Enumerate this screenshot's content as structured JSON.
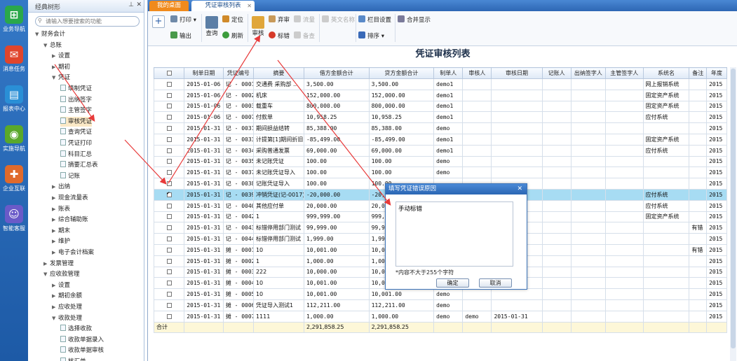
{
  "leftbar": [
    {
      "label": "业务导航",
      "icon": "business-nav-icon",
      "color": "#2aa84a",
      "glyph": "⊞"
    },
    {
      "label": "消息任务",
      "icon": "message-task-icon",
      "color": "#e0452c",
      "glyph": "✉"
    },
    {
      "label": "报表中心",
      "icon": "report-center-icon",
      "color": "#2a8fd6",
      "glyph": "▤"
    },
    {
      "label": "实施导航",
      "icon": "implement-nav-icon",
      "color": "#5aa82a",
      "glyph": "◉"
    },
    {
      "label": "企业互联",
      "icon": "enterprise-link-icon",
      "color": "#e06a2c",
      "glyph": "✚"
    },
    {
      "label": "智能客服",
      "icon": "smart-service-icon",
      "color": "#6a5ac8",
      "glyph": "☺"
    }
  ],
  "tree": {
    "title": "经典树形",
    "search_placeholder": "请输入想要搜索的功能",
    "items": [
      {
        "label": "财务会计",
        "level": 0,
        "arrow": "▼",
        "doc": false
      },
      {
        "label": "总账",
        "level": 1,
        "arrow": "▼",
        "doc": false
      },
      {
        "label": "设置",
        "level": 2,
        "arrow": "▶",
        "doc": false
      },
      {
        "label": "期初",
        "level": 2,
        "arrow": "▶",
        "doc": false
      },
      {
        "label": "凭证",
        "level": 2,
        "arrow": "▼",
        "doc": false
      },
      {
        "label": "填制凭证",
        "level": 3,
        "arrow": "",
        "doc": true
      },
      {
        "label": "出纳签字",
        "level": 3,
        "arrow": "",
        "doc": true
      },
      {
        "label": "主管签字",
        "level": 3,
        "arrow": "",
        "doc": true
      },
      {
        "label": "审核凭证",
        "level": 3,
        "arrow": "",
        "doc": true,
        "selected": true
      },
      {
        "label": "查询凭证",
        "level": 3,
        "arrow": "",
        "doc": true
      },
      {
        "label": "凭证打印",
        "level": 3,
        "arrow": "",
        "doc": true
      },
      {
        "label": "科目汇总",
        "level": 3,
        "arrow": "",
        "doc": true
      },
      {
        "label": "摘要汇总表",
        "level": 3,
        "arrow": "",
        "doc": true
      },
      {
        "label": "记账",
        "level": 3,
        "arrow": "",
        "doc": true
      },
      {
        "label": "出纳",
        "level": 2,
        "arrow": "▶",
        "doc": false
      },
      {
        "label": "现金流量表",
        "level": 2,
        "arrow": "▶",
        "doc": false
      },
      {
        "label": "账表",
        "level": 2,
        "arrow": "▶",
        "doc": false
      },
      {
        "label": "综合辅助账",
        "level": 2,
        "arrow": "▶",
        "doc": false
      },
      {
        "label": "期末",
        "level": 2,
        "arrow": "▶",
        "doc": false
      },
      {
        "label": "维护",
        "level": 2,
        "arrow": "▶",
        "doc": false
      },
      {
        "label": "电子会计档案",
        "level": 2,
        "arrow": "▶",
        "doc": false
      },
      {
        "label": "发票管理",
        "level": 1,
        "arrow": "▶",
        "doc": false
      },
      {
        "label": "应收款管理",
        "level": 1,
        "arrow": "▼",
        "doc": false
      },
      {
        "label": "设置",
        "level": 2,
        "arrow": "▶",
        "doc": false
      },
      {
        "label": "期初余额",
        "level": 2,
        "arrow": "▶",
        "doc": false
      },
      {
        "label": "应收处理",
        "level": 2,
        "arrow": "▶",
        "doc": false
      },
      {
        "label": "收款处理",
        "level": 2,
        "arrow": "▼",
        "doc": false
      },
      {
        "label": "选择收款",
        "level": 3,
        "arrow": "",
        "doc": true
      },
      {
        "label": "收款单据录入",
        "level": 3,
        "arrow": "",
        "doc": true
      },
      {
        "label": "收款单据审核",
        "level": 3,
        "arrow": "",
        "doc": true
      },
      {
        "label": "核汇单",
        "level": 3,
        "arrow": "",
        "doc": true
      }
    ]
  },
  "tabs": {
    "home": "我的桌面",
    "active": "凭证审核列表"
  },
  "toolbar": {
    "add": "+",
    "print": "打印",
    "output": "输出",
    "query": "查询",
    "locate": "定位",
    "refresh": "刷新",
    "audit": "审核",
    "abandon": "弃审",
    "flag_error": "标错",
    "stream": "流量",
    "recheck": "备查",
    "english_name": "英文名称",
    "column_settings": "栏目设置",
    "sort": "排序",
    "merge_display": "合并显示"
  },
  "page_title": "凭证审核列表",
  "table": {
    "headers": [
      "",
      "制单日期",
      "凭证编号",
      "摘要",
      "借方金额合计",
      "贷方金额合计",
      "制单人",
      "审核人",
      "审核日期",
      "记账人",
      "出纳签字人",
      "主管签字人",
      "系统名",
      "备注",
      "年度"
    ],
    "rows": [
      {
        "checked": false,
        "date": "2015-01-06",
        "no": "记 - 0001",
        "summary": "交通费 采购部 ...",
        "debit": "3,500.00",
        "credit": "3,500.00",
        "maker": "demo1",
        "auditor": "",
        "audit_date": "",
        "bookkeeper": "",
        "cashier": "",
        "supervisor": "",
        "system": "网上报销系统",
        "remark": "",
        "year": "2015"
      },
      {
        "checked": false,
        "date": "2015-01-06",
        "no": "记 - 0002",
        "summary": "机床",
        "debit": "152,000.00",
        "credit": "152,000.00",
        "maker": "demo1",
        "auditor": "",
        "audit_date": "",
        "bookkeeper": "",
        "cashier": "",
        "supervisor": "",
        "system": "固定资产系统",
        "remark": "",
        "year": "2015"
      },
      {
        "checked": false,
        "date": "2015-01-06",
        "no": "记 - 0003",
        "summary": "载重车",
        "debit": "800,000.00",
        "credit": "800,000.00",
        "maker": "demo1",
        "auditor": "",
        "audit_date": "",
        "bookkeeper": "",
        "cashier": "",
        "supervisor": "",
        "system": "固定资产系统",
        "remark": "",
        "year": "2015"
      },
      {
        "checked": false,
        "date": "2015-01-06",
        "no": "记 - 0007",
        "summary": "付款单",
        "debit": "10,958.25",
        "credit": "10,958.25",
        "maker": "demo1",
        "auditor": "",
        "audit_date": "",
        "bookkeeper": "",
        "cashier": "",
        "supervisor": "",
        "system": "应付系统",
        "remark": "",
        "year": "2015"
      },
      {
        "checked": false,
        "date": "2015-01-31",
        "no": "记 - 0031",
        "summary": "期间损益结转",
        "debit": "85,388.00",
        "credit": "85,388.00",
        "maker": "demo",
        "auditor": "",
        "audit_date": "",
        "bookkeeper": "",
        "cashier": "",
        "supervisor": "",
        "system": "",
        "remark": "",
        "year": "2015"
      },
      {
        "checked": false,
        "date": "2015-01-31",
        "no": "记 - 0033",
        "summary": "计提第[1]期间折旧",
        "debit": "-85,499.00",
        "credit": "-85,499.00",
        "maker": "demo1",
        "auditor": "",
        "audit_date": "",
        "bookkeeper": "",
        "cashier": "",
        "supervisor": "",
        "system": "固定资产系统",
        "remark": "",
        "year": "2015"
      },
      {
        "checked": false,
        "date": "2015-01-31",
        "no": "记 - 0034",
        "summary": "采购普通发票",
        "debit": "69,000.00",
        "credit": "69,000.00",
        "maker": "demo1",
        "auditor": "",
        "audit_date": "",
        "bookkeeper": "",
        "cashier": "",
        "supervisor": "",
        "system": "应付系统",
        "remark": "",
        "year": "2015"
      },
      {
        "checked": false,
        "date": "2015-01-31",
        "no": "记 - 0035",
        "summary": "未记账凭证",
        "debit": "100.00",
        "credit": "100.00",
        "maker": "demo",
        "auditor": "",
        "audit_date": "",
        "bookkeeper": "",
        "cashier": "",
        "supervisor": "",
        "system": "",
        "remark": "",
        "year": "2015"
      },
      {
        "checked": false,
        "date": "2015-01-31",
        "no": "记 - 0037",
        "summary": "未记账凭证导入",
        "debit": "100.00",
        "credit": "100.00",
        "maker": "demo",
        "auditor": "",
        "audit_date": "",
        "bookkeeper": "",
        "cashier": "",
        "supervisor": "",
        "system": "",
        "remark": "",
        "year": "2015"
      },
      {
        "checked": false,
        "date": "2015-01-31",
        "no": "记 - 0038",
        "summary": "记账凭证导入",
        "debit": "100.00",
        "credit": "100.00",
        "maker": "",
        "auditor": "",
        "audit_date": "",
        "bookkeeper": "",
        "cashier": "",
        "supervisor": "",
        "system": "",
        "remark": "",
        "year": "2015"
      },
      {
        "checked": true,
        "date": "2015-01-31",
        "no": "记 - 0039",
        "summary": "冲销凭证(记-0017)",
        "debit": "-20,000.00",
        "credit": "-20,000.",
        "maker": "",
        "auditor": "",
        "audit_date": "",
        "bookkeeper": "",
        "cashier": "",
        "supervisor": "",
        "system": "应付系统",
        "remark": "",
        "year": "2015",
        "selected": true
      },
      {
        "checked": false,
        "date": "2015-01-31",
        "no": "记 - 0040",
        "summary": "其他应付单",
        "debit": "20,000.00",
        "credit": "20,000.",
        "maker": "",
        "auditor": "",
        "audit_date": "",
        "bookkeeper": "",
        "cashier": "",
        "supervisor": "",
        "system": "应付系统",
        "remark": "",
        "year": "2015"
      },
      {
        "checked": false,
        "date": "2015-01-31",
        "no": "记 - 0042",
        "summary": "1",
        "debit": "999,999.00",
        "credit": "999,999.",
        "maker": "",
        "auditor": "",
        "audit_date": "",
        "bookkeeper": "",
        "cashier": "",
        "supervisor": "",
        "system": "固定资产系统",
        "remark": "",
        "year": "2015"
      },
      {
        "checked": false,
        "date": "2015-01-31",
        "no": "记 - 0043",
        "summary": "标错停用部门测试",
        "debit": "99,999.00",
        "credit": "99,999.",
        "maker": "",
        "auditor": "",
        "audit_date": "",
        "bookkeeper": "",
        "cashier": "",
        "supervisor": "",
        "system": "",
        "remark": "有错",
        "year": "2015"
      },
      {
        "checked": false,
        "date": "2015-01-31",
        "no": "记 - 0044",
        "summary": "标错停用部门测试",
        "debit": "1,999.00",
        "credit": "1,999.0",
        "maker": "",
        "auditor": "",
        "audit_date": "",
        "bookkeeper": "",
        "cashier": "",
        "supervisor": "",
        "system": "",
        "remark": "",
        "year": "2015"
      },
      {
        "checked": false,
        "date": "2015-01-31",
        "no": "摊 - 0001",
        "summary": "10",
        "debit": "10,001.00",
        "credit": "10,001.",
        "maker": "",
        "auditor": "",
        "audit_date": "",
        "bookkeeper": "",
        "cashier": "",
        "supervisor": "",
        "system": "",
        "remark": "有错",
        "year": "2015"
      },
      {
        "checked": false,
        "date": "2015-01-31",
        "no": "摊 - 0002",
        "summary": "1",
        "debit": "1,000.00",
        "credit": "1,000.0",
        "maker": "",
        "auditor": "",
        "audit_date": "",
        "bookkeeper": "",
        "cashier": "",
        "supervisor": "",
        "system": "",
        "remark": "",
        "year": "2015"
      },
      {
        "checked": false,
        "date": "2015-01-31",
        "no": "摊 - 0003",
        "summary": "222",
        "debit": "10,000.00",
        "credit": "10,000.",
        "maker": "",
        "auditor": "",
        "audit_date": "",
        "bookkeeper": "",
        "cashier": "",
        "supervisor": "",
        "system": "",
        "remark": "",
        "year": "2015"
      },
      {
        "checked": false,
        "date": "2015-01-31",
        "no": "摊 - 0004",
        "summary": "10",
        "debit": "10,001.00",
        "credit": "10,001.",
        "maker": "",
        "auditor": "",
        "audit_date": "",
        "bookkeeper": "",
        "cashier": "",
        "supervisor": "",
        "system": "",
        "remark": "",
        "year": "2015"
      },
      {
        "checked": false,
        "date": "2015-01-31",
        "no": "摊 - 0005",
        "summary": "10",
        "debit": "10,001.00",
        "credit": "10,001.00",
        "maker": "demo",
        "auditor": "",
        "audit_date": "",
        "bookkeeper": "",
        "cashier": "",
        "supervisor": "",
        "system": "",
        "remark": "",
        "year": "2015"
      },
      {
        "checked": false,
        "date": "2015-01-31",
        "no": "摊 - 0006",
        "summary": "凭证导入测试1",
        "debit": "112,211.00",
        "credit": "112,211.00",
        "maker": "demo",
        "auditor": "",
        "audit_date": "",
        "bookkeeper": "",
        "cashier": "",
        "supervisor": "",
        "system": "",
        "remark": "",
        "year": "2015"
      },
      {
        "checked": false,
        "date": "2015-01-31",
        "no": "摊 - 0007",
        "summary": "1111",
        "debit": "1,000.00",
        "credit": "1,000.00",
        "maker": "demo",
        "auditor": "demo",
        "audit_date": "2015-01-31",
        "bookkeeper": "",
        "cashier": "",
        "supervisor": "",
        "system": "",
        "remark": "",
        "year": "2015"
      }
    ],
    "total_label": "合计",
    "total_debit": "2,291,858.25",
    "total_credit": "2,291,858.25"
  },
  "dialog": {
    "title": "填写凭证错误原因",
    "value": "手动标错",
    "hint": "*内容不大于255个字符",
    "ok": "确定",
    "cancel": "取消"
  }
}
